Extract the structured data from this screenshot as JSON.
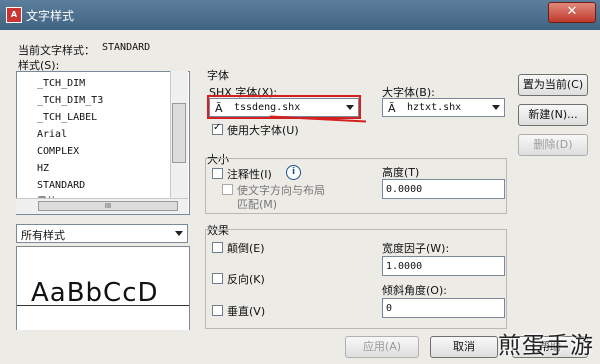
{
  "window": {
    "title": "文字样式",
    "close": "✕"
  },
  "current_style": {
    "label": "当前文字样式：",
    "value": "STANDARD"
  },
  "styles": {
    "label": "样式(S):",
    "items": [
      "_TCH_DIM",
      "_TCH_DIM_T3",
      "_TCH_LABEL",
      "Arial",
      "COMPLEX",
      "HZ",
      "STANDARD",
      "黑体"
    ],
    "selected": "STANDARD",
    "hscroll_label": "III"
  },
  "filter": {
    "value": "所有样式"
  },
  "preview": {
    "text": "AaBbCcD"
  },
  "font": {
    "group_label": "字体",
    "shx_label": "SHX 字体(X):",
    "shx_value": "tssdeng.shx",
    "big_label": "大字体(B):",
    "big_value": "hztxt.shx",
    "use_big_label": "使用大字体(U)",
    "use_big_checked": true
  },
  "size": {
    "group_label": "大小",
    "annotative_label": "注释性(I)",
    "match_label_1": "使文字方向与布局",
    "match_label_2": "匹配(M)",
    "height_label": "高度(T)",
    "height_value": "0.0000"
  },
  "effects": {
    "group_label": "效果",
    "upside_down": "颠倒(E)",
    "backwards": "反向(K)",
    "vertical": "垂直(V)",
    "width_label": "宽度因子(W):",
    "width_value": "1.0000",
    "oblique_label": "倾斜角度(O):",
    "oblique_value": "0"
  },
  "buttons": {
    "set_current": "置为当前(C)",
    "new": "新建(N)...",
    "delete": "删除(D)",
    "apply": "应用(A)",
    "cancel": "取消",
    "help": "帮助"
  },
  "watermark": "煎蛋手游",
  "colors": {
    "title_bar": "#4a6f8f",
    "close": "#c0392b",
    "annotation": "#d42020"
  }
}
